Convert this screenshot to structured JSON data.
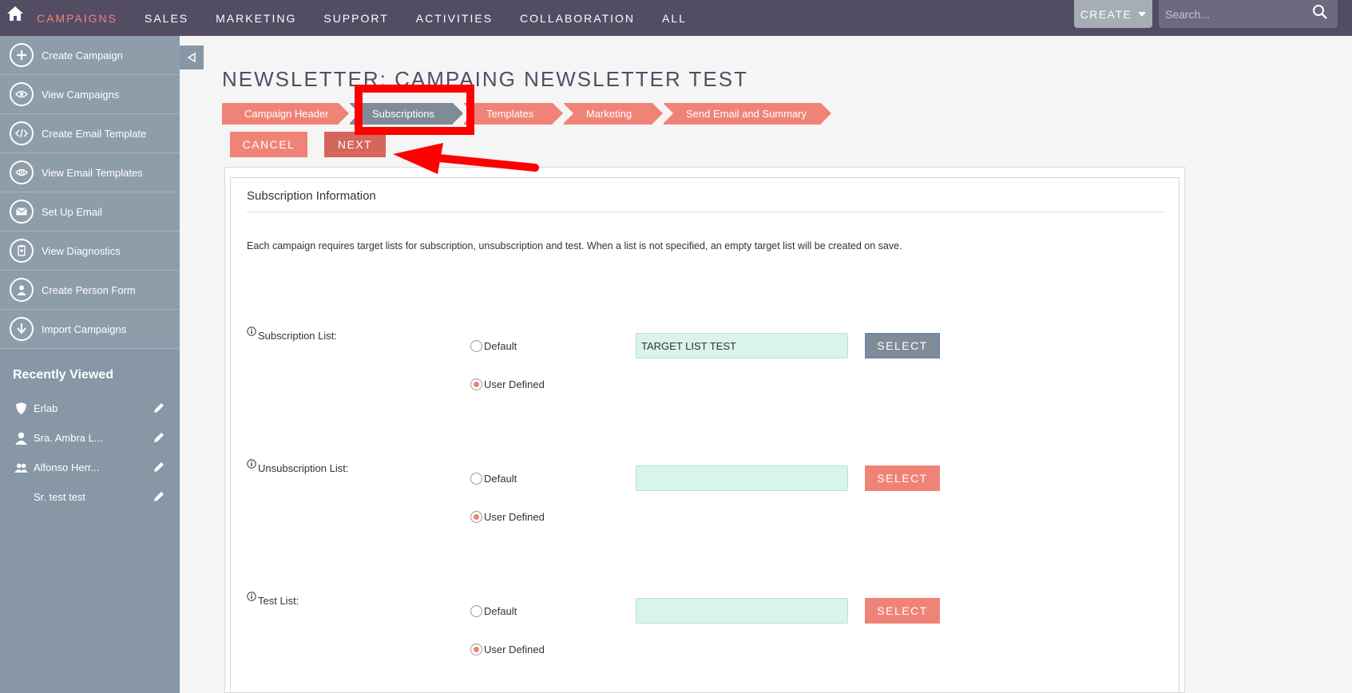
{
  "topbar": {
    "nav": [
      "CAMPAIGNS",
      "SALES",
      "MARKETING",
      "SUPPORT",
      "ACTIVITIES",
      "COLLABORATION",
      "ALL"
    ],
    "active_nav": "CAMPAIGNS",
    "create_label": "CREATE",
    "search_placeholder": "Search..."
  },
  "sidebar": {
    "items": [
      {
        "label": "Create Campaign",
        "icon": "plus-icon"
      },
      {
        "label": "View Campaigns",
        "icon": "eye-icon"
      },
      {
        "label": "Create Email Template",
        "icon": "code-icon"
      },
      {
        "label": "View Email Templates",
        "icon": "eye-target-icon"
      },
      {
        "label": "Set Up Email",
        "icon": "envelope-icon"
      },
      {
        "label": "View Diagnostics",
        "icon": "diagnostics-icon"
      },
      {
        "label": "Create Person Form",
        "icon": "person-icon"
      },
      {
        "label": "Import Campaigns",
        "icon": "download-icon"
      }
    ],
    "recent_title": "Recently Viewed",
    "recent": [
      {
        "label": "Erlab",
        "icon": "shield-icon"
      },
      {
        "label": "Sra. Ambra L...",
        "icon": "user-icon"
      },
      {
        "label": "Alfonso Herr...",
        "icon": "users-icon"
      },
      {
        "label": "Sr. test test",
        "icon": ""
      }
    ]
  },
  "page": {
    "title": "NEWSLETTER: CAMPAING NEWSLETTER TEST",
    "steps": [
      "Campaign Header",
      "Subscriptions",
      "Templates",
      "Marketing",
      "Send Email and Summary"
    ],
    "active_step": "Subscriptions",
    "cancel_label": "CANCEL",
    "next_label": "NEXT"
  },
  "panel": {
    "heading": "Subscription Information",
    "description": "Each campaign requires target lists for subscription, unsubscription and test. When a list is not specified, an empty target list will be created on save.",
    "rows": [
      {
        "label": "Subscription List:",
        "default_label": "Default",
        "user_label": "User Defined",
        "selected": "User Defined",
        "value": "TARGET LIST TEST",
        "button": "SELECT"
      },
      {
        "label": "Unsubscription List:",
        "default_label": "Default",
        "user_label": "User Defined",
        "selected": "User Defined",
        "value": "",
        "button": "SELECT"
      },
      {
        "label": "Test List:",
        "default_label": "Default",
        "user_label": "User Defined",
        "selected": "User Defined",
        "value": "",
        "button": "SELECT"
      }
    ]
  },
  "colors": {
    "topbar": "#534d64",
    "accent": "#f08377",
    "sidebar": "#8797a6",
    "active_step": "#7f8b97",
    "field_bg": "#d9f4ec",
    "annotation": "#ff0000"
  }
}
